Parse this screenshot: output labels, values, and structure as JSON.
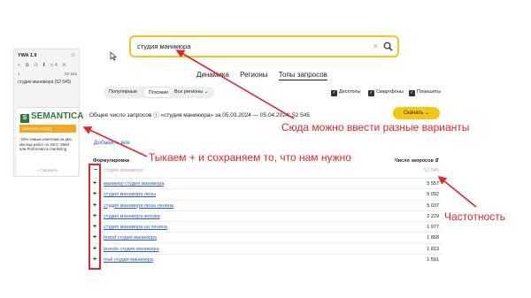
{
  "widget": {
    "title": "YWA 1.9",
    "pin": "⊙",
    "tools": "+ ⧉ ◷ ⬇ x4 ✕",
    "col_left": "1",
    "col_right": "52 545",
    "query": "студия маникюра (52 545)",
    "brand": "SEMANTICA",
    "order_button": "Заказать услугу",
    "promo": "-20% новым клиентам на два месяца работ по SEO, SMM или Performance marketing",
    "collapse": "« Свернуть"
  },
  "search": {
    "value": "студия маникюра",
    "clear": "×"
  },
  "tabs": [
    "Динамика",
    "Регионы",
    "Топы запросов"
  ],
  "filters": {
    "popular": "Популярные",
    "similar": "Похожие",
    "regions": "Все регионы ⌄",
    "devices": [
      {
        "label": "Десктопы",
        "checked": true
      },
      {
        "label": "Смартфоны",
        "checked": true
      },
      {
        "label": "Планшеты",
        "checked": true
      }
    ]
  },
  "total": "Общее число запросов ⓘ «студия маникюра» за 05.03.2024 — 05.04.2024: 52 545",
  "download": "Скачать ⌄",
  "add_all": "Добавить все",
  "table": {
    "col_phrase": "Формулировка",
    "col_count": "Число запросов ⇵",
    "first_row": {
      "prefix": "−",
      "query": "студия маникюра",
      "count": "52 545"
    },
    "rows": [
      {
        "query": "маникюр студия маникюра",
        "count": "5 557"
      },
      {
        "query": "студия маникюра лены",
        "count": "5 092"
      },
      {
        "query": "студия маникюра лены ленина",
        "count": "5 037"
      },
      {
        "query": "студия маникюра москва",
        "count": "2 229"
      },
      {
        "query": "студия маникюра на ленина",
        "count": "1 977"
      },
      {
        "query": "brand студия маникюра",
        "count": "1 868"
      },
      {
        "query": "brands студия маникюра",
        "count": "1 813"
      },
      {
        "query": "mail студия маникюра",
        "count": "1 591"
      }
    ],
    "plus": "+"
  },
  "annotations": {
    "a1": "Сюда можно ввести разные варианты",
    "a2": "Тыкаем + и сохраняем то, что нам нужно",
    "a3": "Частотность"
  },
  "colors": {
    "accent": "#f5c518",
    "annotation": "#e3252a",
    "link": "#2a5dc4",
    "brand": "#2c7a3a"
  }
}
